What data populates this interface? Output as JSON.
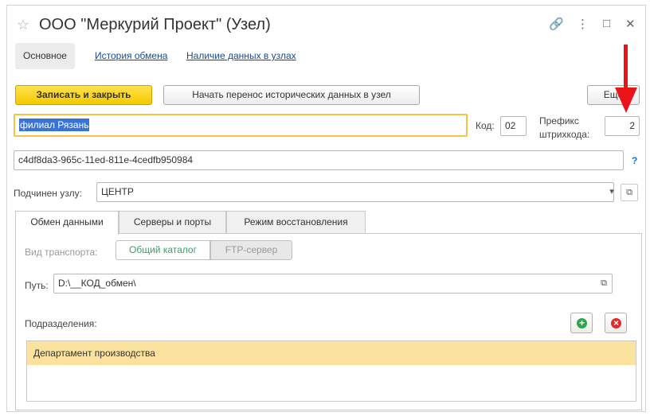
{
  "window": {
    "title": "ООО \"Меркурий Проект\" (Узел)",
    "link_icon": "🔗",
    "more_icon": "⋮",
    "maximize_icon": "□",
    "close_icon": "✕"
  },
  "nav_tabs": {
    "main": "Основное",
    "history": "История обмена",
    "data_in_nodes": "Наличие данных в узлах"
  },
  "toolbar": {
    "save_close": "Записать и закрыть",
    "start_transfer": "Начать перенос исторических данных в узел",
    "more": "Ещё"
  },
  "form": {
    "name_value": "филиал Рязань",
    "code_label": "Код:",
    "code_value": "02",
    "prefix_label_1": "Префикс",
    "prefix_label_2": "штрихкода:",
    "prefix_value": "2",
    "guid_value": "c4df8da3-965c-11ed-811e-4cedfb950984",
    "help": "?",
    "parent_label": "Подчинен узлу:",
    "parent_value": "ЦЕНТР",
    "dropdown_icon": "▾",
    "open_icon": "⧉"
  },
  "inner_tabs": {
    "exchange": "Обмен данными",
    "servers": "Серверы и порты",
    "recovery": "Режим восстановления"
  },
  "exchange": {
    "transport_label": "Вид транспорта:",
    "transport_option_1": "Общий каталог",
    "transport_option_2": "FTP-сервер",
    "path_label": "Путь:",
    "path_value": "D:\\__КОД_обмен\\",
    "divisions_label": "Подразделения:",
    "add_icon": "+",
    "remove_icon": "×",
    "divisions": [
      "Департамент производства"
    ]
  },
  "colors": {
    "primary_button": "#f5c800",
    "selection_row": "#fbe29e",
    "add_green": "#2ea44f",
    "remove_red": "#e02a2a",
    "arrow_red": "#e8141a"
  }
}
